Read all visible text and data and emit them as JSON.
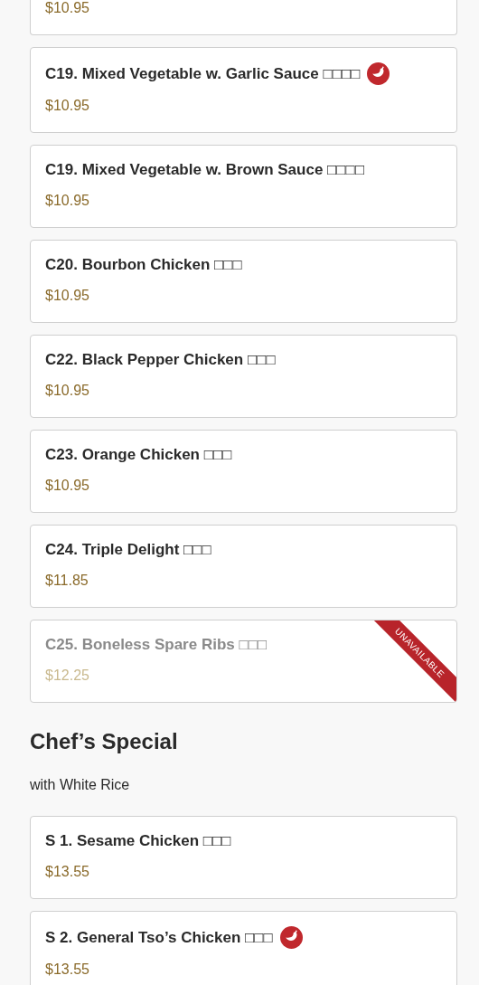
{
  "cut_item": {
    "price": "$10.95"
  },
  "items": [
    {
      "name": "C19. Mixed Vegetable w. Garlic Sauce □□□□",
      "price": "$10.95",
      "spicy": true,
      "available": true
    },
    {
      "name": "C19. Mixed Vegetable w. Brown Sauce □□□□",
      "price": "$10.95",
      "spicy": false,
      "available": true
    },
    {
      "name": "C20. Bourbon Chicken □□□",
      "price": "$10.95",
      "spicy": false,
      "available": true
    },
    {
      "name": "C22. Black Pepper Chicken □□□",
      "price": "$10.95",
      "spicy": false,
      "available": true
    },
    {
      "name": "C23. Orange Chicken □□□",
      "price": "$10.95",
      "spicy": false,
      "available": true
    },
    {
      "name": "C24. Triple Delight □□□",
      "price": "$11.85",
      "spicy": false,
      "available": true
    },
    {
      "name": "C25. Boneless Spare Ribs □□□",
      "price": "$12.25",
      "spicy": false,
      "available": false,
      "badge": "UNAVAILABLE"
    }
  ],
  "section": {
    "title": "Chef’s Special",
    "subtitle": "with White Rice",
    "items": [
      {
        "name": "S 1. Sesame Chicken □□□",
        "price": "$13.55",
        "spicy": false,
        "available": true
      },
      {
        "name": "S 2. General Tso’s Chicken □□□",
        "price": "$13.55",
        "spicy": true,
        "available": true
      }
    ]
  }
}
